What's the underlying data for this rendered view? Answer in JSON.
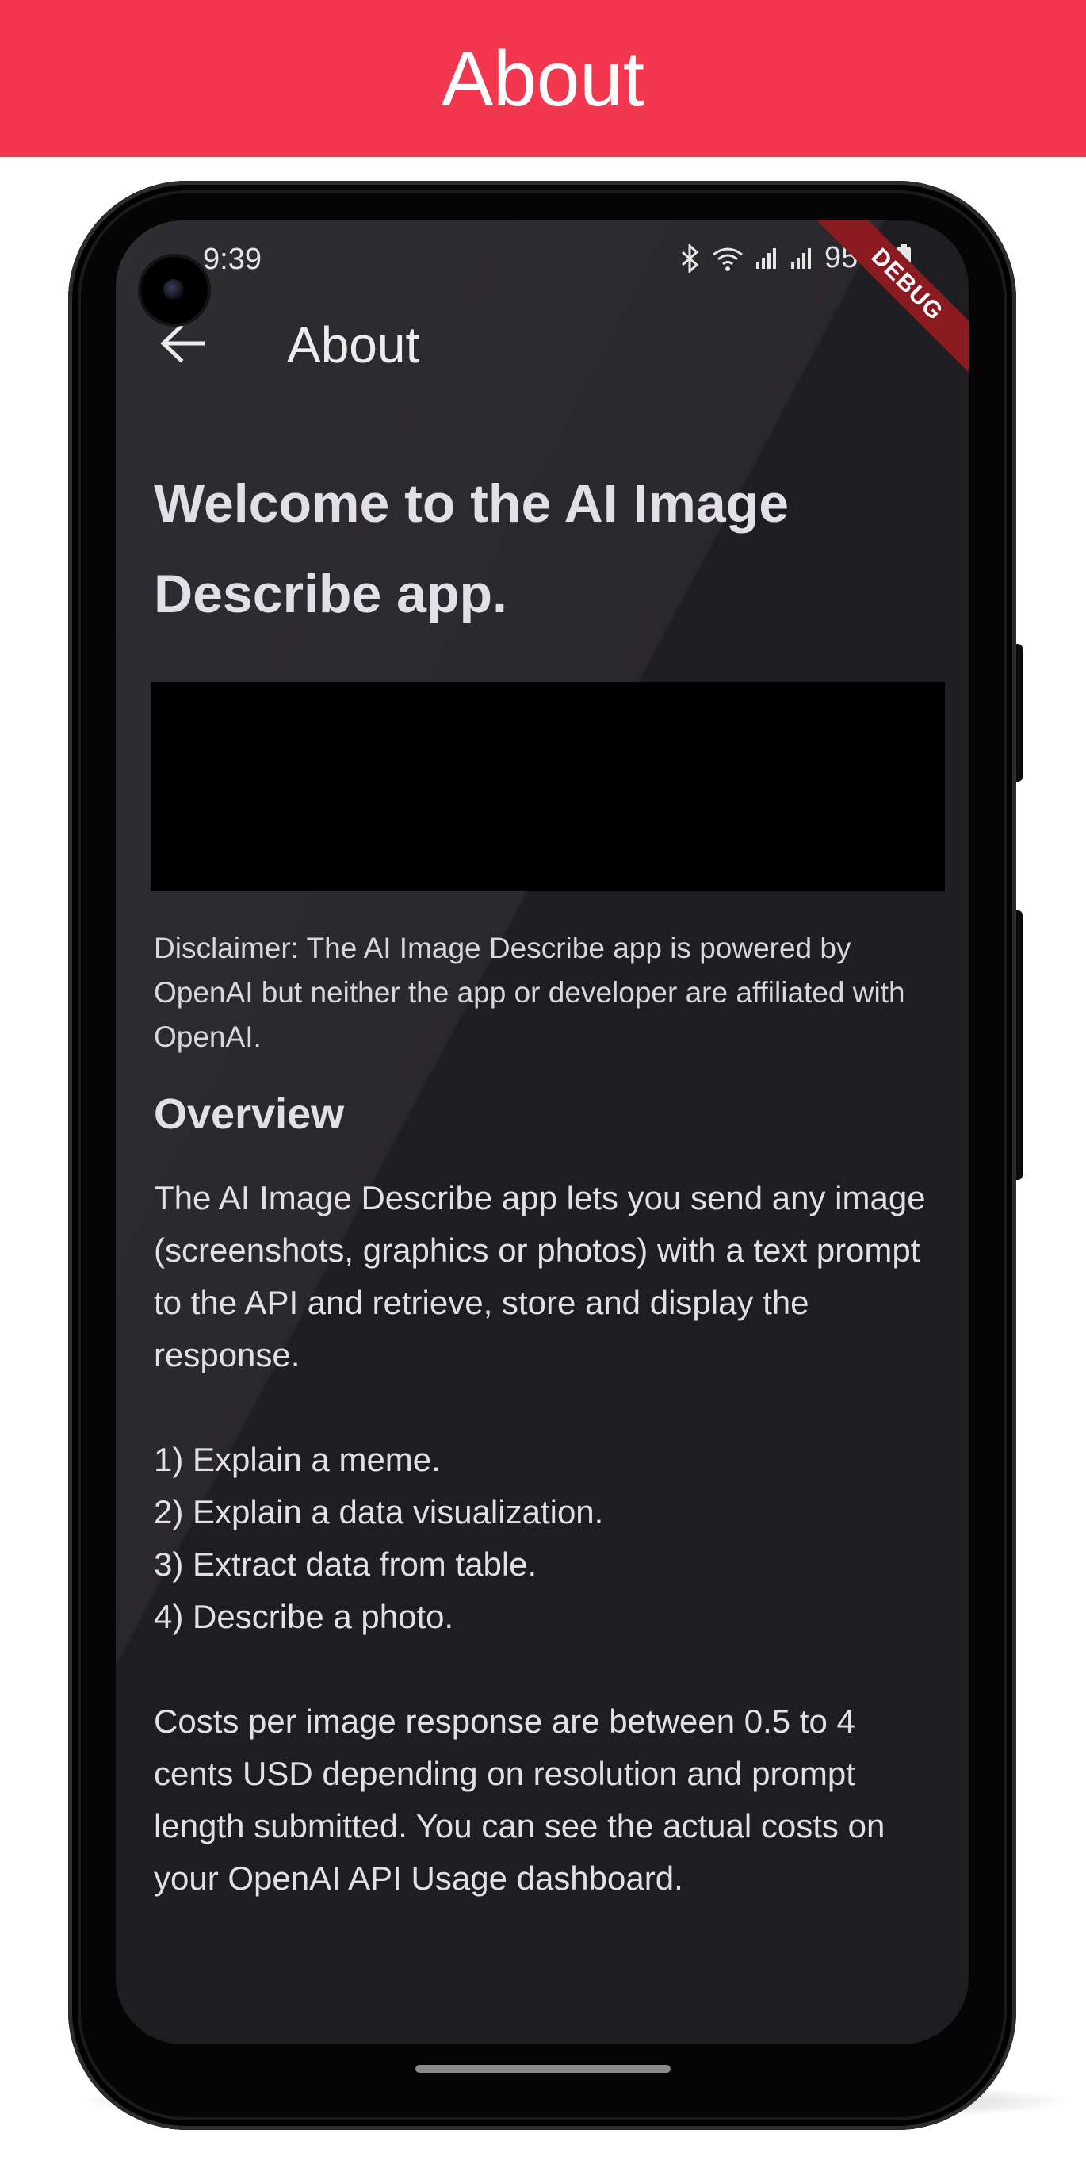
{
  "banner": {
    "title": "About"
  },
  "status_bar": {
    "time": "9:39",
    "battery": "95%"
  },
  "debug_banner": "DEBUG",
  "app_bar": {
    "title": "About",
    "back_icon": "arrow-left-icon"
  },
  "content": {
    "welcome": "Welcome to the AI Image Describe app.",
    "disclaimer": "Disclaimer: The AI Image Describe app is powered by OpenAI but neither the app or developer are affiliated with OpenAI.",
    "overview_heading": "Overview",
    "overview_body": "The AI Image Describe app lets you send any image (screenshots, graphics or photos) with a text prompt to the API and  retrieve, store and display the response.\n\n1) Explain a meme.\n2) Explain a data visualization.\n3) Extract data from table.\n4) Describe a photo.\n\nCosts per image response are between 0.5 to 4 cents USD depending on resolution and prompt length submitted. You can see the actual costs on your OpenAI API Usage dashboard."
  },
  "colors": {
    "banner": "#f2374f",
    "screen_background": "#1e1d22",
    "debug_ribbon": "#8b1b21"
  }
}
